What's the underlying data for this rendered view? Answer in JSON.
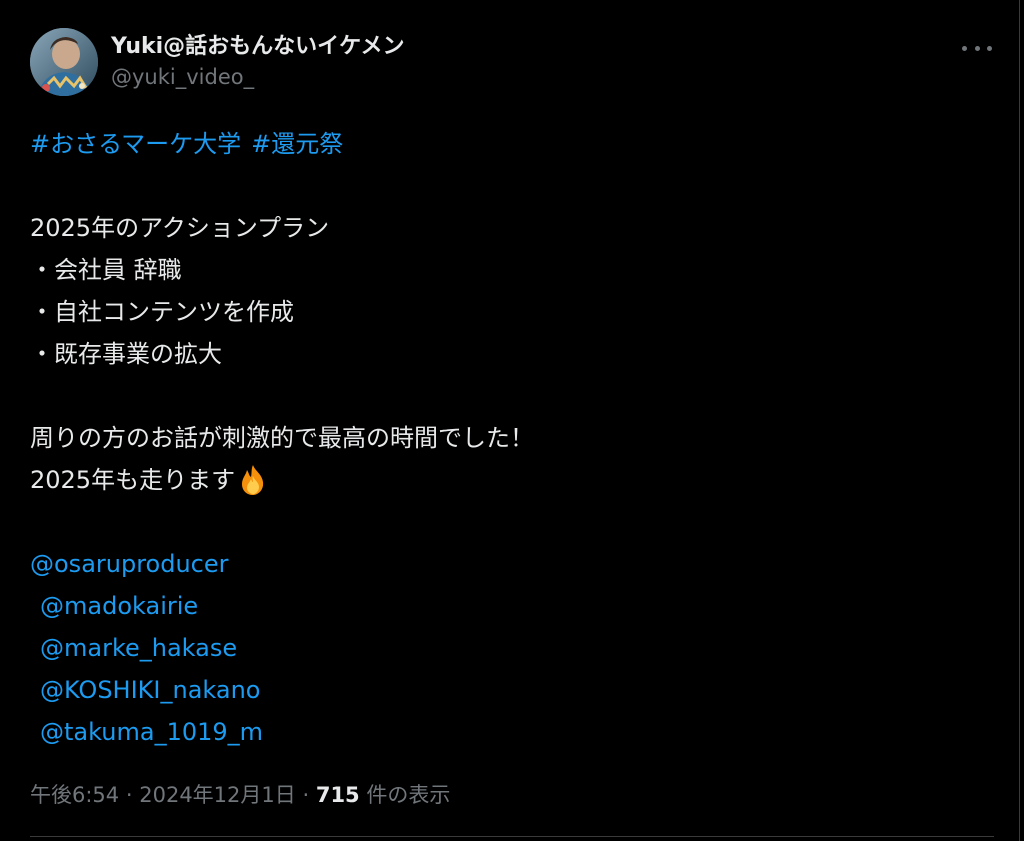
{
  "author": {
    "display_name": "Yuki@話おもんないイケメン",
    "handle": "@yuki_video_"
  },
  "tweet": {
    "hashtags": [
      "#おさるマーケ大学",
      "#還元祭"
    ],
    "plan_title": "2025年のアクションプラン",
    "plan_items": [
      "・会社員 辞職",
      "・自社コンテンツを作成",
      "・既存事業の拡大"
    ],
    "message_line1": "周りの方のお話が刺激的で最高の時間でした！",
    "message_line2": "2025年も走ります",
    "emoji": "fire-icon",
    "mentions": [
      "@osaruproducer",
      "@madokairie",
      "@marke_hakase",
      "@KOSHIKI_nakano",
      "@takuma_1019_m"
    ]
  },
  "meta": {
    "time": "午後6:54",
    "separator": "·",
    "date": "2024年12月1日",
    "views_count": "715",
    "views_label": "件の表示"
  },
  "colors": {
    "background": "#000000",
    "text": "#e7e9ea",
    "secondary": "#71767b",
    "link": "#1d9bf0"
  }
}
